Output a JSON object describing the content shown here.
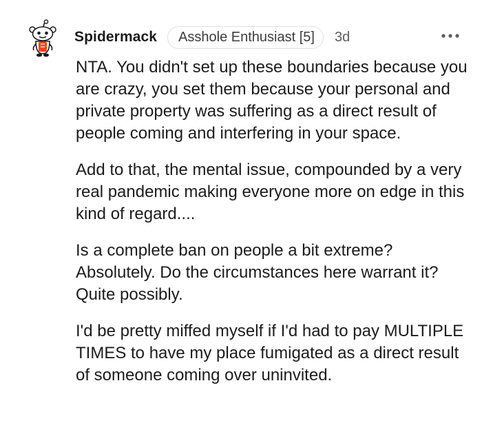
{
  "comment": {
    "author": "Spidermack",
    "flair": "Asshole Enthusiast [5]",
    "timestamp": "3d",
    "icons": {
      "avatar": "snoo-avatar-icon",
      "more": "more-options-icon"
    },
    "paragraphs": [
      "NTA. You didn't set up these boundaries because you are crazy, you set them because your personal and private property was suffering as a direct result of people coming and interfering in your space.",
      "Add to that, the mental issue, compounded by a very real pandemic making everyone more on edge in this kind of regard....",
      "Is a complete ban on people a bit extreme? Absolutely. Do the circumstances here warrant it? Quite possibly.",
      "I'd be pretty miffed myself if I'd had to pay MULTIPLE TIMES to have my place fumigated as a direct result of someone coming over uninvited."
    ]
  },
  "colors": {
    "text": "#1c1c1c",
    "muted": "#5c5c5c",
    "flair_border": "#e0e0e0",
    "avatar_accent": "#ff4500"
  }
}
